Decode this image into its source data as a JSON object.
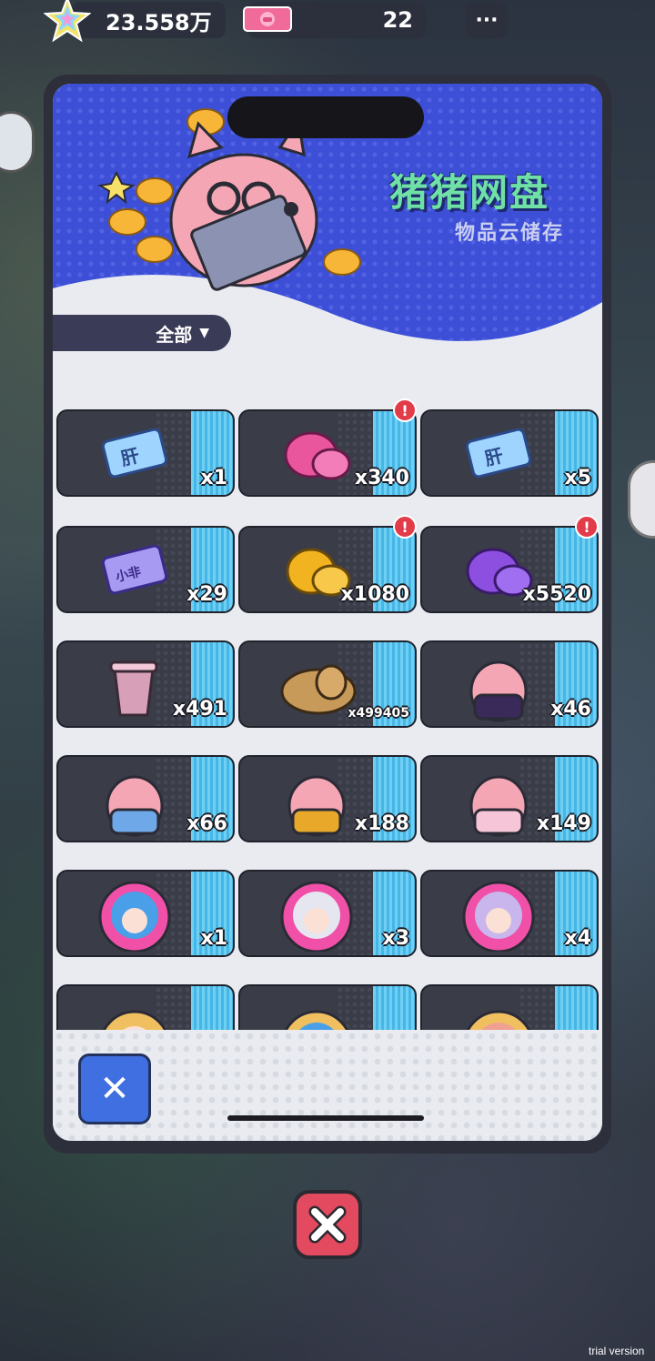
{
  "topbar": {
    "stars_value": "23.558万",
    "tickets_value": "22",
    "more_label": "···"
  },
  "banner": {
    "title": "猪猪网盘",
    "subtitle": "物品云储存"
  },
  "filter": {
    "label": "全部"
  },
  "items": [
    {
      "icon": "liver-ticket-icon",
      "count": "x1"
    },
    {
      "icon": "pink-gem-icon",
      "count": "x340",
      "alert": true
    },
    {
      "icon": "liver-ticket-icon",
      "count": "x5"
    },
    {
      "icon": "fei-ticket-icon",
      "count": "x29"
    },
    {
      "icon": "gold-gem-icon",
      "count": "x1080",
      "alert": true
    },
    {
      "icon": "purple-gem-icon",
      "count": "x5520",
      "alert": true
    },
    {
      "icon": "bubble-tea-icon",
      "count": "x491"
    },
    {
      "icon": "bread-icon",
      "count": "x499405"
    },
    {
      "icon": "pig-costume-purple-icon",
      "count": "x46"
    },
    {
      "icon": "pig-costume-blue-icon",
      "count": "x66"
    },
    {
      "icon": "pig-costume-yellow-icon",
      "count": "x188"
    },
    {
      "icon": "pig-costume-pink-icon",
      "count": "x149"
    },
    {
      "icon": "avatar-blue-hair-icon",
      "count": "x1"
    },
    {
      "icon": "avatar-silver-hair-icon",
      "count": "x3"
    },
    {
      "icon": "avatar-lavender-hair-icon",
      "count": "x4"
    },
    {
      "icon": "avatar-blonde-icon",
      "count": ""
    },
    {
      "icon": "avatar-blue-icon",
      "count": ""
    },
    {
      "icon": "avatar-pink-icon",
      "count": ""
    }
  ],
  "actions": {
    "close_label": "✕"
  },
  "watermark": "trial version",
  "colors": {
    "accent_blue": "#3f6fe0",
    "title_green": "#6fe1a6",
    "banner_blue": "#3c4fd6",
    "alert_red": "#e23b4a"
  }
}
